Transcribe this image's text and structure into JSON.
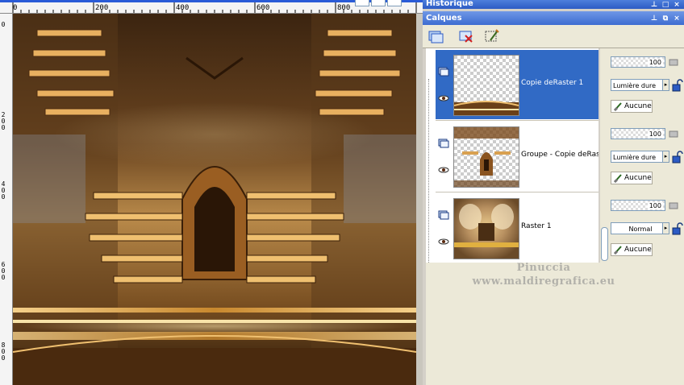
{
  "ruler": {
    "top_labels": [
      "0",
      "200",
      "400",
      "600",
      "800"
    ],
    "left_labels": [
      "0",
      "2",
      "0",
      "0",
      "4",
      "0",
      "0",
      "6",
      "0",
      "0",
      "8",
      "0",
      "0"
    ]
  },
  "palettes": {
    "history_title": "Historique",
    "layers_title": "Calques"
  },
  "layers": [
    {
      "name": "Copie deRaster 1",
      "selected": true,
      "opacity": "100",
      "blend_mode": "Lumière dure",
      "mask": "Aucune"
    },
    {
      "name": "Groupe - Copie deRaster",
      "selected": false,
      "opacity": "100",
      "blend_mode": "Lumière dure",
      "mask": "Aucune"
    },
    {
      "name": "Raster 1",
      "selected": false,
      "opacity": "100",
      "blend_mode": "Normal",
      "mask": "Aucune"
    }
  ],
  "watermark": {
    "line1": "Pinuccia",
    "line2": "www.maldiregrafica.eu"
  },
  "icons": {
    "toolbar": [
      "new-layer-icon",
      "delete-layer-icon",
      "layer-properties-icon"
    ],
    "row": [
      "layer-visibility-icon",
      "eye-icon"
    ],
    "props": [
      "opacity-slider-icon",
      "lock-icon",
      "mask-brush-icon"
    ]
  },
  "colors": {
    "selection": "#316ac5",
    "titlebar": "#2c5bc4",
    "panel": "#ece9d8"
  }
}
